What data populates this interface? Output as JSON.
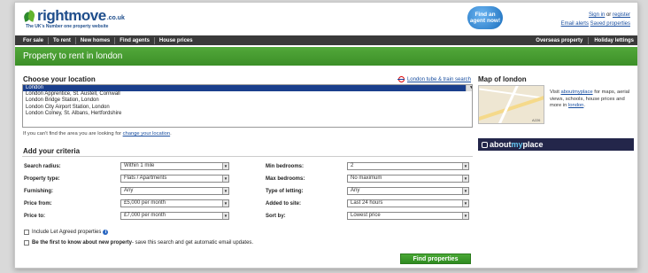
{
  "header": {
    "logo_word": "rightmove",
    "logo_suffix": ".co.uk",
    "tagline": "The UK's Number one property website",
    "agent_button": "Find an agent now!",
    "signin": "Sign in",
    "signin_or": "or",
    "register": "register",
    "email_alerts": "Email alerts",
    "saved_properties": "Saved properties"
  },
  "nav": {
    "left": [
      "For sale",
      "To rent",
      "New homes",
      "Find agents",
      "House prices"
    ],
    "right": [
      "Overseas property",
      "Holiday lettings"
    ]
  },
  "banner": {
    "title": "Property to rent in london"
  },
  "location": {
    "title": "Choose your location",
    "tube_link": "London tube & train search",
    "options": [
      "London",
      "London Apprentice, St. Austell, Cornwall",
      "London Bridge Station, London",
      "London City Airport Station, London",
      "London Colney, St. Albans, Hertfordshire"
    ],
    "selected_index": 0,
    "hint_prefix": "If you can't find the area you are looking for",
    "hint_link": "change your location",
    "hint_suffix": "."
  },
  "criteria": {
    "title": "Add your criteria",
    "left_fields": [
      {
        "label": "Search radius:",
        "value": "Within 1 mile"
      },
      {
        "label": "Property type:",
        "value": "Flats / Apartments"
      },
      {
        "label": "Furnishing:",
        "value": "Any"
      },
      {
        "label": "Price from:",
        "value": "£5,000 per month"
      },
      {
        "label": "Price to:",
        "value": "£7,000 per month"
      }
    ],
    "right_fields": [
      {
        "label": "Min bedrooms:",
        "value": "2"
      },
      {
        "label": "Max bedrooms:",
        "value": "No maximum"
      },
      {
        "label": "Type of letting:",
        "value": "Any"
      },
      {
        "label": "Added to site:",
        "value": "Last 24 hours"
      },
      {
        "label": "Sort by:",
        "value": "Lowest price"
      }
    ],
    "let_agreed": "Include Let Agreed properties",
    "alert_bold": "Be the first to know about new property",
    "alert_rest": " - save this search and get automatic email updates.",
    "find_button": "Find properties"
  },
  "map": {
    "title": "Map of london",
    "desc_prefix": "Visit",
    "desc_link": "aboutmyplace",
    "desc_mid": "for maps, aerial views, schools, house prices and more in",
    "desc_link2": "london",
    "desc_suffix": ".",
    "aboutbar_a": "about",
    "aboutbar_b": "my",
    "aboutbar_c": "place",
    "road_label": "A226"
  },
  "colors": {
    "brand_green": "#3c8f28",
    "nav_dark": "#3a3a3a",
    "link_blue": "#1a4fa0",
    "selected_blue": "#1a3f8c",
    "about_navy": "#23264a"
  }
}
